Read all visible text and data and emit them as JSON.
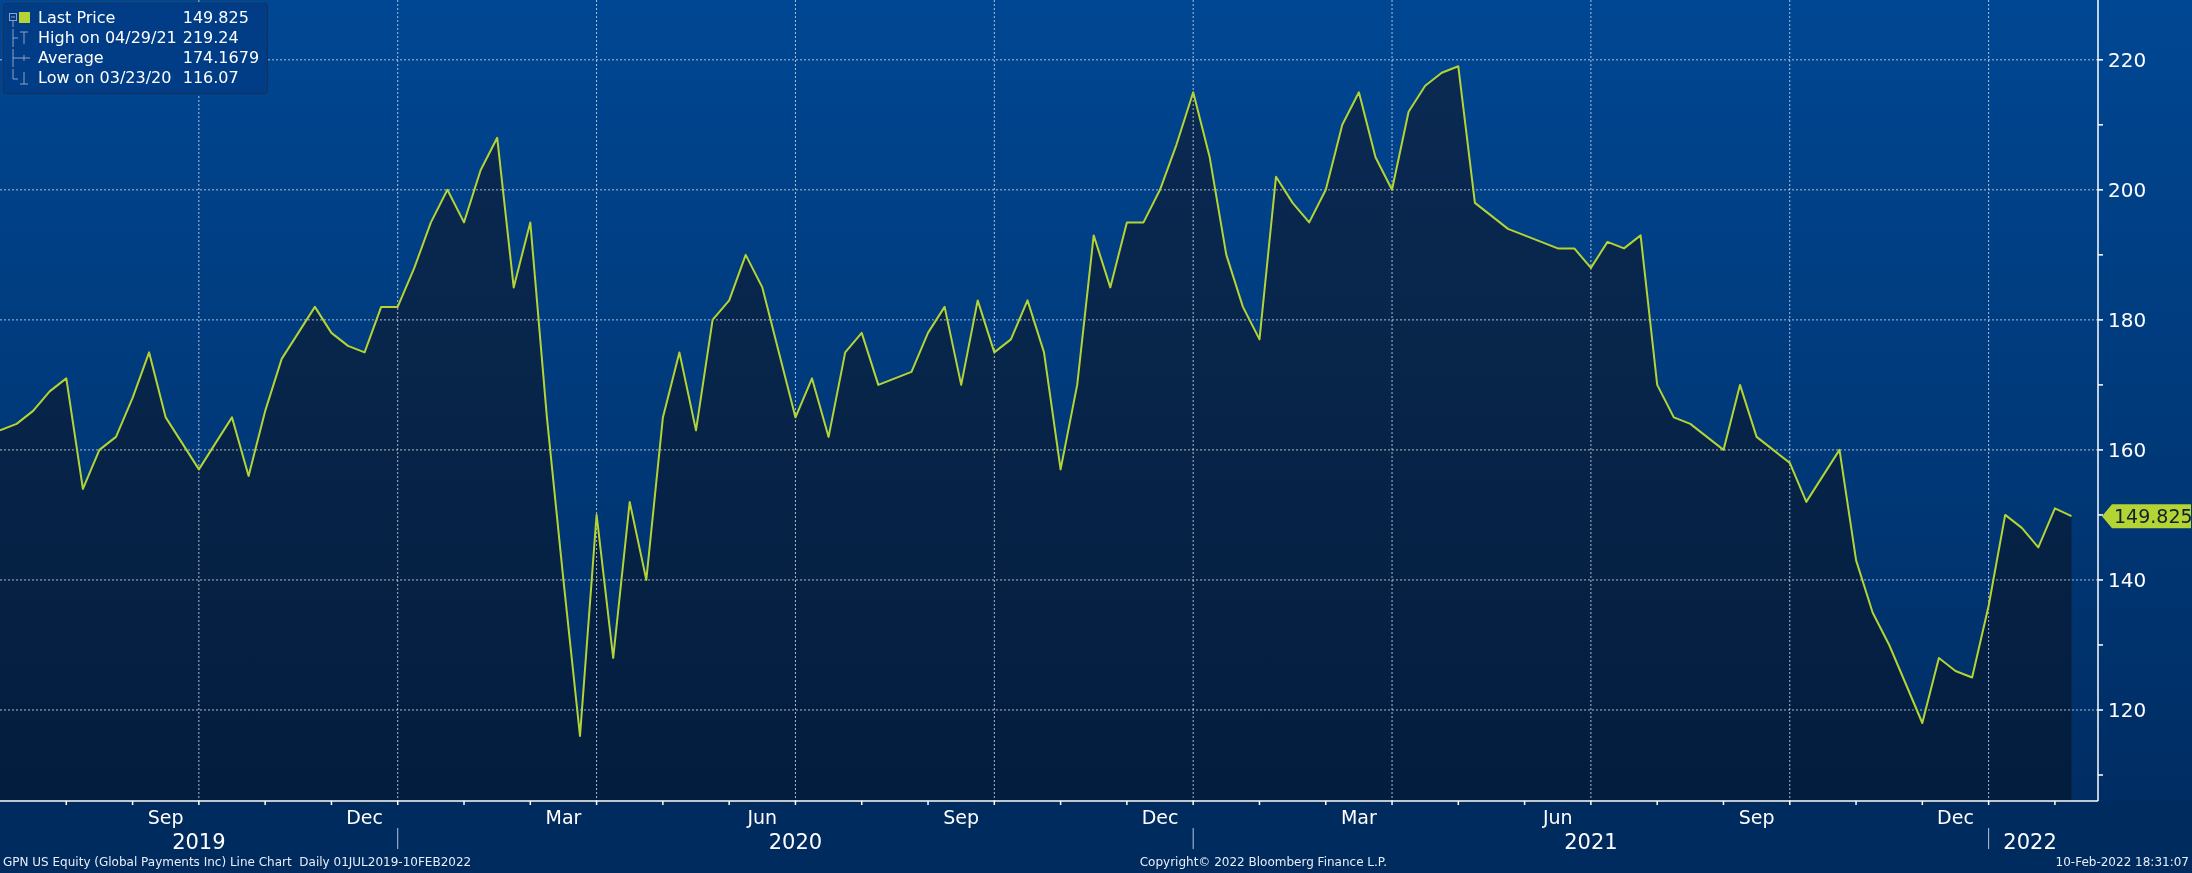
{
  "legend": [
    {
      "kind": "price",
      "value": "149.825"
    },
    {
      "kind": "high",
      "label": "High on 04/29/21",
      "value": "219.24"
    },
    {
      "kind": "average",
      "label": "Average",
      "value": "174.1679"
    },
    {
      "kind": "low",
      "label": "Low on 03/23/20",
      "value": "116.07"
    }
  ],
  "chart": {
    "last_price_tag": "149.825",
    "year_labels": [
      "2019",
      "2020",
      "2021",
      "2022"
    ],
    "chart_data": {
      "type": "area",
      "grid": true,
      "ylim": [
        106,
        229.2
      ],
      "yticks": [
        120,
        140,
        160,
        180,
        200,
        220
      ],
      "categories": [
        null,
        null,
        null,
        null,
        null,
        null,
        null,
        null,
        null,
        null,
        "Sep",
        null,
        null,
        null,
        null,
        null,
        null,
        null,
        null,
        null,
        null,
        null,
        "Dec",
        null,
        null,
        null,
        null,
        null,
        null,
        null,
        null,
        null,
        null,
        null,
        "Mar",
        null,
        null,
        null,
        null,
        null,
        null,
        null,
        null,
        null,
        null,
        null,
        "Jun",
        null,
        null,
        null,
        null,
        null,
        null,
        null,
        null,
        null,
        null,
        null,
        "Sep",
        null,
        null,
        null,
        null,
        null,
        null,
        null,
        null,
        null,
        null,
        null,
        "Dec",
        null,
        null,
        null,
        null,
        null,
        null,
        null,
        null,
        null,
        null,
        null,
        "Mar",
        null,
        null,
        null,
        null,
        null,
        null,
        null,
        null,
        null,
        null,
        null,
        "Jun",
        null,
        null,
        null,
        null,
        null,
        null,
        null,
        null,
        null,
        null,
        null,
        "Sep",
        null,
        null,
        null,
        null,
        null,
        null,
        null,
        null,
        null,
        null,
        null,
        "Dec",
        null,
        null,
        null,
        null,
        null,
        null,
        null
      ],
      "series": [
        {
          "name": "Last Price",
          "color": "#b4d334",
          "values": [
            163,
            164,
            166,
            169,
            171,
            154,
            160,
            162,
            168,
            175,
            165,
            161,
            157,
            161,
            165,
            156,
            166,
            174,
            178,
            182,
            178,
            176,
            175,
            182,
            182,
            188,
            195,
            200,
            195,
            203,
            208,
            185,
            195,
            165,
            140,
            116,
            150,
            128,
            152,
            140,
            165,
            175,
            163,
            180,
            183,
            190,
            185,
            175,
            165,
            171,
            162,
            175,
            178,
            170,
            171,
            172,
            178,
            182,
            170,
            183,
            175,
            177,
            183,
            175,
            157,
            170,
            193,
            185,
            195,
            195,
            200,
            207,
            215,
            205,
            190,
            182,
            177,
            202,
            198,
            195,
            200,
            210,
            215,
            205,
            200,
            212,
            216,
            218,
            219,
            198,
            196,
            194,
            193,
            192,
            191,
            191,
            188,
            192,
            191,
            193,
            170,
            165,
            164,
            162,
            160,
            170,
            162,
            160,
            158,
            152,
            156,
            160,
            143,
            135,
            130,
            124,
            118,
            128,
            126,
            125,
            136,
            150,
            148,
            145,
            151,
            149.8
          ]
        }
      ]
    }
  },
  "footer": {
    "description": "GPN US Equity (Global Payments Inc) Line Chart  Daily 01JUL2019-10FEB2022",
    "copyright": "Copyright© 2022 Bloomberg Finance L.P.",
    "timestamp": "10-Feb-2022 18:31:07"
  }
}
